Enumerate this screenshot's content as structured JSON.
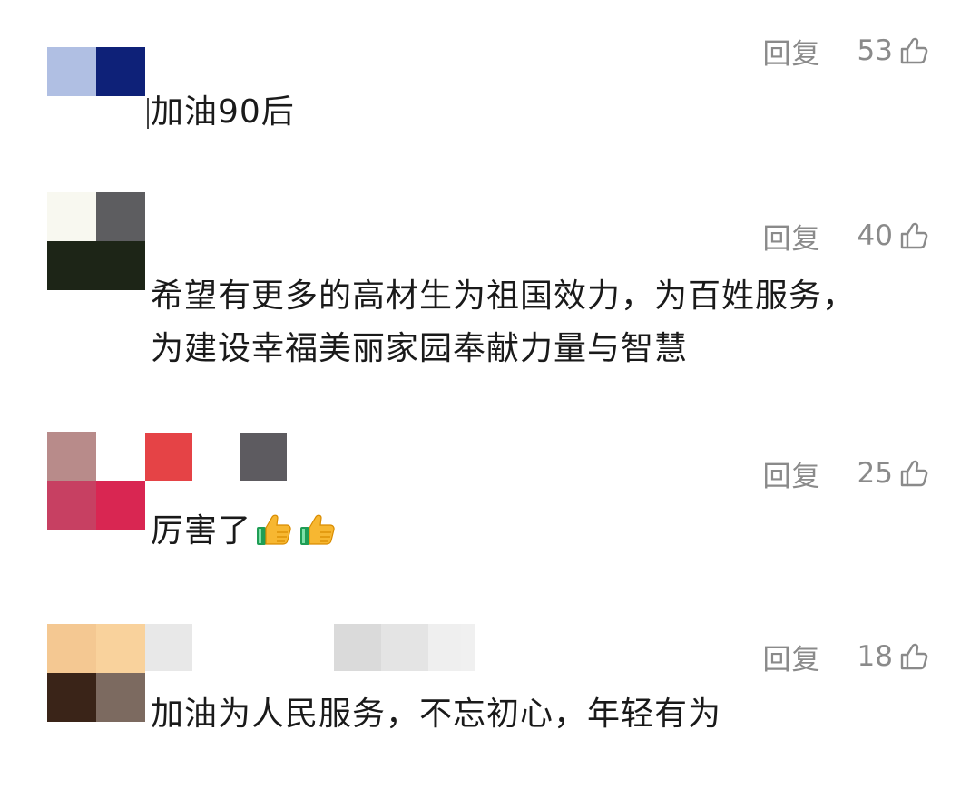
{
  "comments": [
    {
      "text": "加油90后",
      "reply_label": "回复",
      "likes": "53",
      "avatar_colors": [
        "#b0bfe3",
        "#0e2178",
        "#ffffff",
        "#ffffff"
      ]
    },
    {
      "text": "希望有更多的高材生为祖国效力，为百姓服务，为建设幸福美丽家园奉献力量与智慧",
      "reply_label": "回复",
      "likes": "40",
      "avatar_colors": [
        "#f8f8f0",
        "#5d5d60",
        "#1d2517",
        "#1d2517"
      ]
    },
    {
      "text": "厉害了",
      "reply_label": "回复",
      "likes": "25",
      "avatar_colors": [
        "#b88b8a",
        "#ffffff",
        "#c74062",
        "#d92652"
      ],
      "name_blur_colors": [
        "#e54346",
        "#ffffff",
        "#5d5b60"
      ],
      "emojis": [
        "thumbs-up-emoji",
        "thumbs-up-emoji"
      ]
    },
    {
      "text": "加油为人民服务，不忘初心，年轻有为",
      "reply_label": "回复",
      "likes": "18",
      "avatar_colors": [
        "#f4c892",
        "#f9d29c",
        "#3a2418",
        "#7c6a60"
      ],
      "name_blur_colors": [
        "#e6e6e6",
        "#ffffff",
        "#ffffff",
        "#d6d6d6",
        "#e2e2e2",
        "#eeeeee"
      ]
    }
  ],
  "icons": {
    "like": "thumb-up-outline-icon",
    "emoji": "thumbs-up-emoji"
  },
  "colors": {
    "text": "#1a1a1a",
    "meta": "#8a8a8a",
    "background": "#ffffff"
  }
}
